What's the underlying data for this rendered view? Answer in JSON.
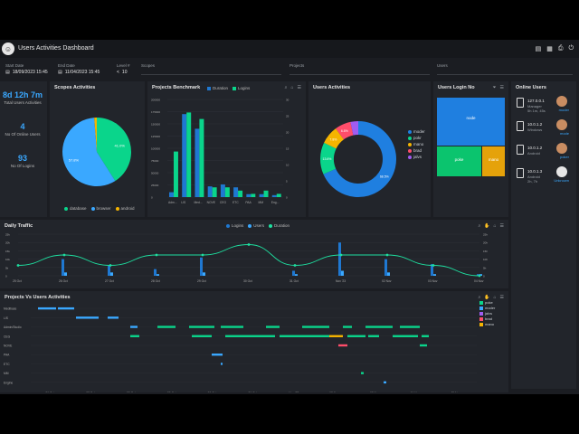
{
  "app": {
    "title": "Users Activities Dashboard",
    "logo_icon": "users-icon",
    "toolbar_icons": [
      "export-icon",
      "report-icon",
      "print-icon",
      "power-icon"
    ]
  },
  "filters": {
    "start_date": {
      "label": "Start Date",
      "value": "18/09/2023 15:45"
    },
    "end_date": {
      "label": "End Date",
      "value": "11/04/2023 15:45"
    },
    "level": {
      "label": "Level #",
      "value": "10"
    },
    "scopes": {
      "label": "Scopes",
      "placeholder": "Scopes"
    },
    "projects": {
      "label": "Projects",
      "placeholder": "Projects"
    },
    "users": {
      "label": "Users",
      "placeholder": "Users"
    }
  },
  "kpis": [
    {
      "value": "8d 12h 7m",
      "label": "Total Users Activities"
    },
    {
      "value": "4",
      "label": "No Of Online Users"
    },
    {
      "value": "93",
      "label": "No Of Logins"
    }
  ],
  "scopes_panel": {
    "title": "Scopes Activities",
    "legend": [
      "database",
      "browser",
      "android"
    ],
    "colors": [
      "#0ad58b",
      "#3aa8ff",
      "#f5b400"
    ]
  },
  "bench_panel": {
    "title": "Projects Benchmark",
    "legend": [
      "Duration",
      "Logins"
    ]
  },
  "users_panel": {
    "title": "Users Activities",
    "legend": [
      "moder",
      "pokr",
      "mano",
      "brad",
      "jalvs"
    ]
  },
  "login_panel": {
    "title": "Users Login No",
    "cells": [
      "node",
      "poke",
      "mano"
    ]
  },
  "online_panel": {
    "title": "Online Users",
    "users": [
      {
        "ip": "127.0.0.1",
        "os": "Manager",
        "extra": "5h 1m, 45s",
        "name": "moder"
      },
      {
        "ip": "10.0.1.2",
        "os": "Windows",
        "name": "mode"
      },
      {
        "ip": "10.0.1.2",
        "os": "Android",
        "name": "poker"
      },
      {
        "ip": "10.0.1.3",
        "os": "Android",
        "extra": "2h, 7h",
        "name": "Unknown"
      }
    ]
  },
  "traffic_panel": {
    "title": "Daily Traffic",
    "legend": [
      "Logins",
      "Users",
      "Duration"
    ]
  },
  "pvu_panel": {
    "title": "Projects Vs Users Activities",
    "legend": [
      "poke",
      "moder",
      "jalvs",
      "brad",
      "mano"
    ]
  },
  "chart_data": [
    {
      "type": "pie",
      "title": "Scopes Activities",
      "categories": [
        "database",
        "browser",
        "android"
      ],
      "values": [
        41.0,
        57.8,
        1.2
      ],
      "labels": [
        "41.0%",
        "57.8%",
        ""
      ]
    },
    {
      "type": "bar",
      "title": "Projects Benchmark",
      "categories": [
        "Adm...",
        "LIS",
        "Med...",
        "NOVE",
        "CEG",
        "ETC",
        "PAA",
        "MM",
        "Eng..."
      ],
      "series": [
        {
          "name": "Duration",
          "values": [
            10000,
            170000,
            140000,
            22000,
            26000,
            20000,
            6000,
            6000,
            4000
          ]
        },
        {
          "name": "Logins",
          "values": [
            14,
            26,
            24,
            3,
            3,
            2,
            1,
            2,
            1
          ]
        }
      ],
      "ylim": [
        0,
        200000
      ],
      "y2lim": [
        0,
        30
      ]
    },
    {
      "type": "pie",
      "title": "Users Activities",
      "categories": [
        "moder",
        "pokr",
        "mano",
        "brad",
        "jalvs"
      ],
      "values": [
        68.5,
        13.6,
        7.8,
        6.8,
        3.3
      ],
      "labels": [
        "68.5%",
        "13.6%",
        "7.8%",
        "6.8%",
        ""
      ],
      "donut": true
    },
    {
      "type": "heatmap",
      "title": "Users Login No",
      "categories": [
        "node",
        "poke",
        "mano"
      ],
      "values": [
        50,
        35,
        15
      ]
    },
    {
      "type": "bar",
      "title": "Daily Traffic",
      "categories": [
        "25 Oct",
        "26 Oct",
        "27 Oct",
        "28 Oct",
        "29 Oct",
        "30 Oct",
        "31 Oct",
        "Nov '23",
        "02 Nov",
        "03 Nov",
        "04 Nov"
      ],
      "series": [
        {
          "name": "Logins",
          "values": [
            0,
            10,
            6,
            4,
            11,
            0,
            3,
            20,
            10,
            7,
            1
          ]
        },
        {
          "name": "Users",
          "values": [
            0,
            2,
            2,
            1,
            2,
            0,
            1,
            3,
            2,
            1,
            1
          ]
        },
        {
          "name": "Duration",
          "values": [
            1,
            2,
            1,
            2,
            2,
            3,
            1,
            2,
            2,
            1,
            0
          ]
        }
      ],
      "ylim": [
        0,
        25
      ]
    },
    {
      "type": "scatter",
      "title": "Projects Vs Users Activities",
      "categories": [
        "Medibase",
        "LIS",
        "Admin/Studio",
        "CEG",
        "NOVE",
        "PAA",
        "ETC",
        "MM",
        "Engine"
      ],
      "x": [
        "26 Oct",
        "27 Oct",
        "28 Oct",
        "29 Oct",
        "30 Oct",
        "31 Oct",
        "Nov '23",
        "02 Nov",
        "03 Nov",
        "04 Nov",
        "05 Nov"
      ],
      "series": [
        {
          "name": "poke"
        },
        {
          "name": "moder"
        },
        {
          "name": "jalvs"
        },
        {
          "name": "brad"
        },
        {
          "name": "mano"
        }
      ]
    }
  ]
}
